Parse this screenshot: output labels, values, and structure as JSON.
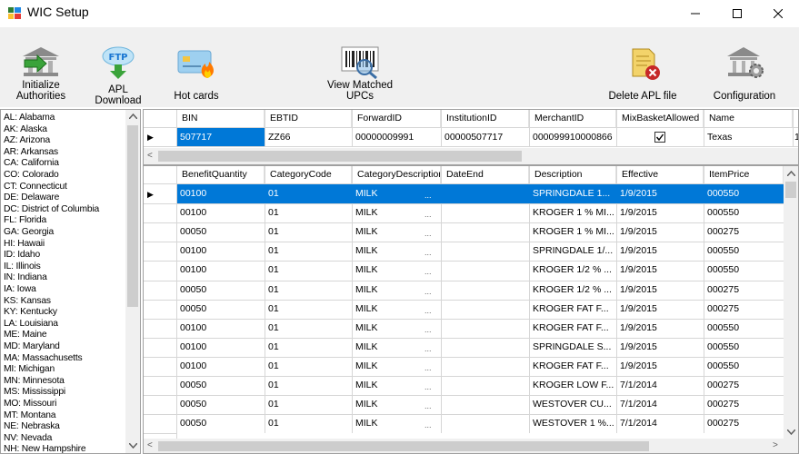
{
  "window": {
    "title": "WIC Setup"
  },
  "toolbar": {
    "initialize": "Initialize Authorities",
    "initialize_l1": "Initialize",
    "initialize_l2": "Authorities",
    "apl_download_l1": "APL",
    "apl_download_l2": "Download",
    "ftp_label": "FTP",
    "hot_cards": "Hot cards",
    "view_matched_l1": "View Matched",
    "view_matched_l2": "UPCs",
    "delete_apl": "Delete APL file",
    "configuration": "Configuration"
  },
  "states": [
    "AL: Alabama",
    "AK: Alaska",
    "AZ: Arizona",
    "AR: Arkansas",
    "CA: California",
    "CO: Colorado",
    "CT: Connecticut",
    "DE: Delaware",
    "DC: District of Columbia",
    "FL: Florida",
    "GA: Georgia",
    "HI: Hawaii",
    "ID: Idaho",
    "IL: Illinois",
    "IN: Indiana",
    "IA: Iowa",
    "KS: Kansas",
    "KY: Kentucky",
    "LA: Louisiana",
    "ME: Maine",
    "MD: Maryland",
    "MA: Massachusetts",
    "MI: Michigan",
    "MN: Minnesota",
    "MS: Mississippi",
    "MO: Missouri",
    "MT: Montana",
    "NE: Nebraska",
    "NV: Nevada",
    "NH: New Hampshire"
  ],
  "top_grid": {
    "headers": [
      "BIN",
      "EBTID",
      "ForwardID",
      "InstitutionID",
      "MerchantID",
      "MixBasketAllowed",
      "Name"
    ],
    "row": {
      "bin": "507717",
      "ebtid": "ZZ66",
      "forward_id": "00000009991",
      "institution_id": "00000507717",
      "merchant_id": "000099910000866",
      "mix_basket": true,
      "name": "Texas",
      "overflow": "1"
    }
  },
  "main_grid": {
    "headers": [
      "BenefitQuantity",
      "CategoryCode",
      "CategoryDescription",
      "DateEnd",
      "Description",
      "Effective",
      "ItemPrice"
    ],
    "ellipsis": "...",
    "rows": [
      [
        "00100",
        "01",
        "MILK",
        "SPRINGDALE 1...",
        "1/9/2015",
        "000550"
      ],
      [
        "00100",
        "01",
        "MILK",
        "KROGER 1 % MI...",
        "1/9/2015",
        "000550"
      ],
      [
        "00050",
        "01",
        "MILK",
        "KROGER 1 % MI...",
        "1/9/2015",
        "000275"
      ],
      [
        "00100",
        "01",
        "MILK",
        "SPRINGDALE 1/...",
        "1/9/2015",
        "000550"
      ],
      [
        "00100",
        "01",
        "MILK",
        "KROGER 1/2 % ...",
        "1/9/2015",
        "000550"
      ],
      [
        "00050",
        "01",
        "MILK",
        "KROGER 1/2 % ...",
        "1/9/2015",
        "000275"
      ],
      [
        "00050",
        "01",
        "MILK",
        "KROGER FAT F...",
        "1/9/2015",
        "000275"
      ],
      [
        "00100",
        "01",
        "MILK",
        "KROGER FAT F...",
        "1/9/2015",
        "000550"
      ],
      [
        "00100",
        "01",
        "MILK",
        "SPRINGDALE S...",
        "1/9/2015",
        "000550"
      ],
      [
        "00100",
        "01",
        "MILK",
        "KROGER FAT F...",
        "1/9/2015",
        "000550"
      ],
      [
        "00050",
        "01",
        "MILK",
        "KROGER LOW F...",
        "7/1/2014",
        "000275"
      ],
      [
        "00050",
        "01",
        "MILK",
        "WESTOVER CU...",
        "7/1/2014",
        "000275"
      ],
      [
        "00050",
        "01",
        "MILK",
        "WESTOVER 1 %...",
        "7/1/2014",
        "000275"
      ]
    ]
  },
  "colors": {
    "selection": "#0078d7",
    "toolbar_bg": "#f0f0f0",
    "grid_line": "#d6d6d6"
  }
}
